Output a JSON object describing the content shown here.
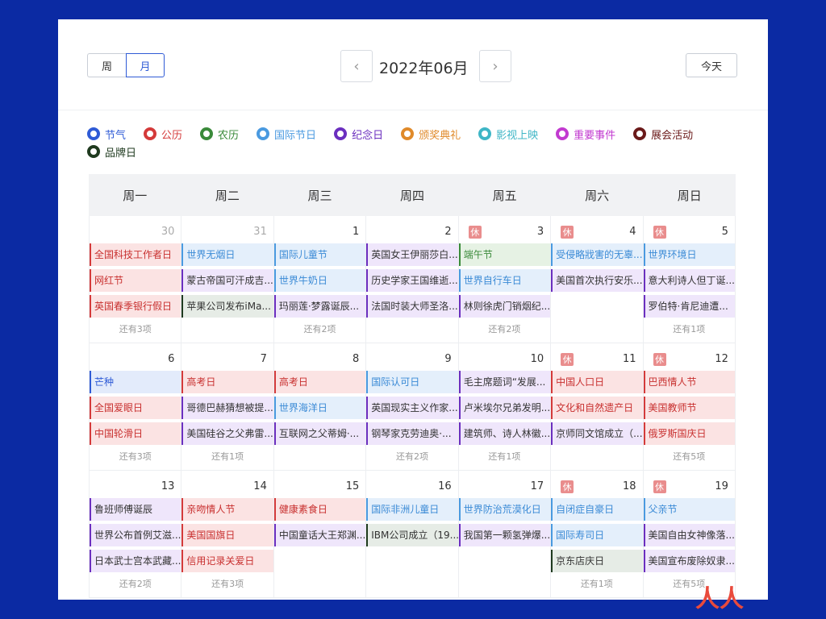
{
  "header": {
    "view_week": "周",
    "view_month": "月",
    "prev": "‹",
    "next": "›",
    "title": "2022年06月",
    "today": "今天"
  },
  "legend": [
    {
      "label": "节气",
      "color": "#2f5bd6"
    },
    {
      "label": "公历",
      "color": "#d43a3a"
    },
    {
      "label": "农历",
      "color": "#3a8a3a"
    },
    {
      "label": "国际节日",
      "color": "#4a9ae0"
    },
    {
      "label": "纪念日",
      "color": "#6b2fbf"
    },
    {
      "label": "颁奖典礼",
      "color": "#e08a2a"
    },
    {
      "label": "影视上映",
      "color": "#3fb6c6"
    },
    {
      "label": "重要事件",
      "color": "#c23ad0"
    },
    {
      "label": "展会活动",
      "color": "#6b1a1a"
    },
    {
      "label": "品牌日",
      "color": "#1f3a1f"
    }
  ],
  "weekdays": [
    "周一",
    "周二",
    "周三",
    "周四",
    "周五",
    "周六",
    "周日"
  ],
  "weeks": [
    [
      {
        "num": "30",
        "muted": true,
        "rest": false,
        "events": [
          {
            "t": "全国科技工作者日",
            "c": "r"
          },
          {
            "t": "网红节",
            "c": "r"
          },
          {
            "t": "英国春季银行假日",
            "c": "r"
          }
        ],
        "more": "还有3项"
      },
      {
        "num": "31",
        "muted": true,
        "rest": false,
        "events": [
          {
            "t": "世界无烟日",
            "c": "b"
          },
          {
            "t": "蒙古帝国可汗成吉...",
            "c": "p"
          },
          {
            "t": "苹果公司发布iMa...",
            "c": "g"
          }
        ],
        "more": ""
      },
      {
        "num": "1",
        "muted": false,
        "rest": false,
        "events": [
          {
            "t": "国际儿童节",
            "c": "b"
          },
          {
            "t": "世界牛奶日",
            "c": "b"
          },
          {
            "t": "玛丽莲·梦露诞辰...",
            "c": "p"
          }
        ],
        "more": "还有2项"
      },
      {
        "num": "2",
        "muted": false,
        "rest": false,
        "events": [
          {
            "t": "英国女王伊丽莎白...",
            "c": "p"
          },
          {
            "t": "历史学家王国维逝...",
            "c": "p"
          },
          {
            "t": "法国时装大师圣洛...",
            "c": "p"
          }
        ],
        "more": ""
      },
      {
        "num": "3",
        "muted": false,
        "rest": true,
        "events": [
          {
            "t": "端午节",
            "c": "gr"
          },
          {
            "t": "世界自行车日",
            "c": "b"
          },
          {
            "t": "林则徐虎门销烟纪...",
            "c": "p"
          }
        ],
        "more": "还有2项"
      },
      {
        "num": "4",
        "muted": false,
        "rest": true,
        "events": [
          {
            "t": "受侵略戕害的无辜...",
            "c": "b"
          },
          {
            "t": "美国首次执行安乐...",
            "c": "p"
          }
        ],
        "more": ""
      },
      {
        "num": "5",
        "muted": false,
        "rest": true,
        "events": [
          {
            "t": "世界环境日",
            "c": "b"
          },
          {
            "t": "意大利诗人但丁诞...",
            "c": "p"
          },
          {
            "t": "罗伯特·肯尼迪遭...",
            "c": "p"
          }
        ],
        "more": "还有1项"
      }
    ],
    [
      {
        "num": "6",
        "muted": false,
        "rest": false,
        "events": [
          {
            "t": "芒种",
            "c": "jq"
          },
          {
            "t": "全国爱眼日",
            "c": "r"
          },
          {
            "t": "中国轮滑日",
            "c": "r"
          }
        ],
        "more": "还有3项"
      },
      {
        "num": "7",
        "muted": false,
        "rest": false,
        "events": [
          {
            "t": "高考日",
            "c": "r"
          },
          {
            "t": "哥德巴赫猜想被提...",
            "c": "p"
          },
          {
            "t": "美国硅谷之父弗雷...",
            "c": "p"
          }
        ],
        "more": "还有1项"
      },
      {
        "num": "8",
        "muted": false,
        "rest": false,
        "events": [
          {
            "t": "高考日",
            "c": "r"
          },
          {
            "t": "世界海洋日",
            "c": "b"
          },
          {
            "t": "互联网之父蒂姆·...",
            "c": "p"
          }
        ],
        "more": ""
      },
      {
        "num": "9",
        "muted": false,
        "rest": false,
        "events": [
          {
            "t": "国际认可日",
            "c": "b"
          },
          {
            "t": "英国现实主义作家...",
            "c": "p"
          },
          {
            "t": "钢琴家克劳迪奥·...",
            "c": "p"
          }
        ],
        "more": "还有2项"
      },
      {
        "num": "10",
        "muted": false,
        "rest": false,
        "events": [
          {
            "t": "毛主席题词“发展...",
            "c": "p"
          },
          {
            "t": "卢米埃尔兄弟发明...",
            "c": "p"
          },
          {
            "t": "建筑师、诗人林徽...",
            "c": "p"
          }
        ],
        "more": "还有1项"
      },
      {
        "num": "11",
        "muted": false,
        "rest": true,
        "events": [
          {
            "t": "中国人口日",
            "c": "r"
          },
          {
            "t": "文化和自然遗产日",
            "c": "r"
          },
          {
            "t": "京师同文馆成立（...",
            "c": "p"
          }
        ],
        "more": ""
      },
      {
        "num": "12",
        "muted": false,
        "rest": true,
        "events": [
          {
            "t": "巴西情人节",
            "c": "r"
          },
          {
            "t": "美国教师节",
            "c": "r"
          },
          {
            "t": "俄罗斯国庆日",
            "c": "r"
          }
        ],
        "more": "还有5项"
      }
    ],
    [
      {
        "num": "13",
        "muted": false,
        "rest": false,
        "events": [
          {
            "t": "鲁班师傅诞辰",
            "c": "p"
          },
          {
            "t": "世界公布首例艾滋...",
            "c": "p"
          },
          {
            "t": "日本武士宫本武藏...",
            "c": "p"
          }
        ],
        "more": "还有2项"
      },
      {
        "num": "14",
        "muted": false,
        "rest": false,
        "events": [
          {
            "t": "亲吻情人节",
            "c": "r"
          },
          {
            "t": "美国国旗日",
            "c": "r"
          },
          {
            "t": "信用记录关爱日",
            "c": "r"
          }
        ],
        "more": "还有3项"
      },
      {
        "num": "15",
        "muted": false,
        "rest": false,
        "events": [
          {
            "t": "健康素食日",
            "c": "r"
          },
          {
            "t": "中国童话大王郑渊...",
            "c": "p"
          }
        ],
        "more": ""
      },
      {
        "num": "16",
        "muted": false,
        "rest": false,
        "events": [
          {
            "t": "国际非洲儿童日",
            "c": "b"
          },
          {
            "t": "IBM公司成立（19...",
            "c": "g"
          }
        ],
        "more": ""
      },
      {
        "num": "17",
        "muted": false,
        "rest": false,
        "events": [
          {
            "t": "世界防治荒漠化日",
            "c": "b"
          },
          {
            "t": "我国第一颗氢弹爆...",
            "c": "p"
          }
        ],
        "more": ""
      },
      {
        "num": "18",
        "muted": false,
        "rest": true,
        "events": [
          {
            "t": "自闭症自豪日",
            "c": "b"
          },
          {
            "t": "国际寿司日",
            "c": "b"
          },
          {
            "t": "京东店庆日",
            "c": "g"
          }
        ],
        "more": "还有1项"
      },
      {
        "num": "19",
        "muted": false,
        "rest": true,
        "events": [
          {
            "t": "父亲节",
            "c": "b"
          },
          {
            "t": "美国自由女神像落...",
            "c": "p"
          },
          {
            "t": "美国宣布废除奴隶...",
            "c": "p"
          }
        ],
        "more": "还有5项"
      }
    ]
  ],
  "event_styles": {
    "r": {
      "bg": "#fbe3e3",
      "border": "#d43a3a",
      "fg": "#c8302f"
    },
    "b": {
      "bg": "#e4effb",
      "border": "#4a9ae0",
      "fg": "#3a8ad6"
    },
    "p": {
      "bg": "#efe6fb",
      "border": "#6b2fbf",
      "fg": "#333333"
    },
    "g": {
      "bg": "#e6ece6",
      "border": "#1f3a1f",
      "fg": "#333333"
    },
    "gr": {
      "bg": "#e6f2e4",
      "border": "#3a8a3a",
      "fg": "#3a8a3a"
    },
    "jq": {
      "bg": "#e3ebfb",
      "border": "#2f5bd6",
      "fg": "#2f5bd6"
    }
  },
  "watermark": "人人都是产品经理",
  "rest_label": "休"
}
